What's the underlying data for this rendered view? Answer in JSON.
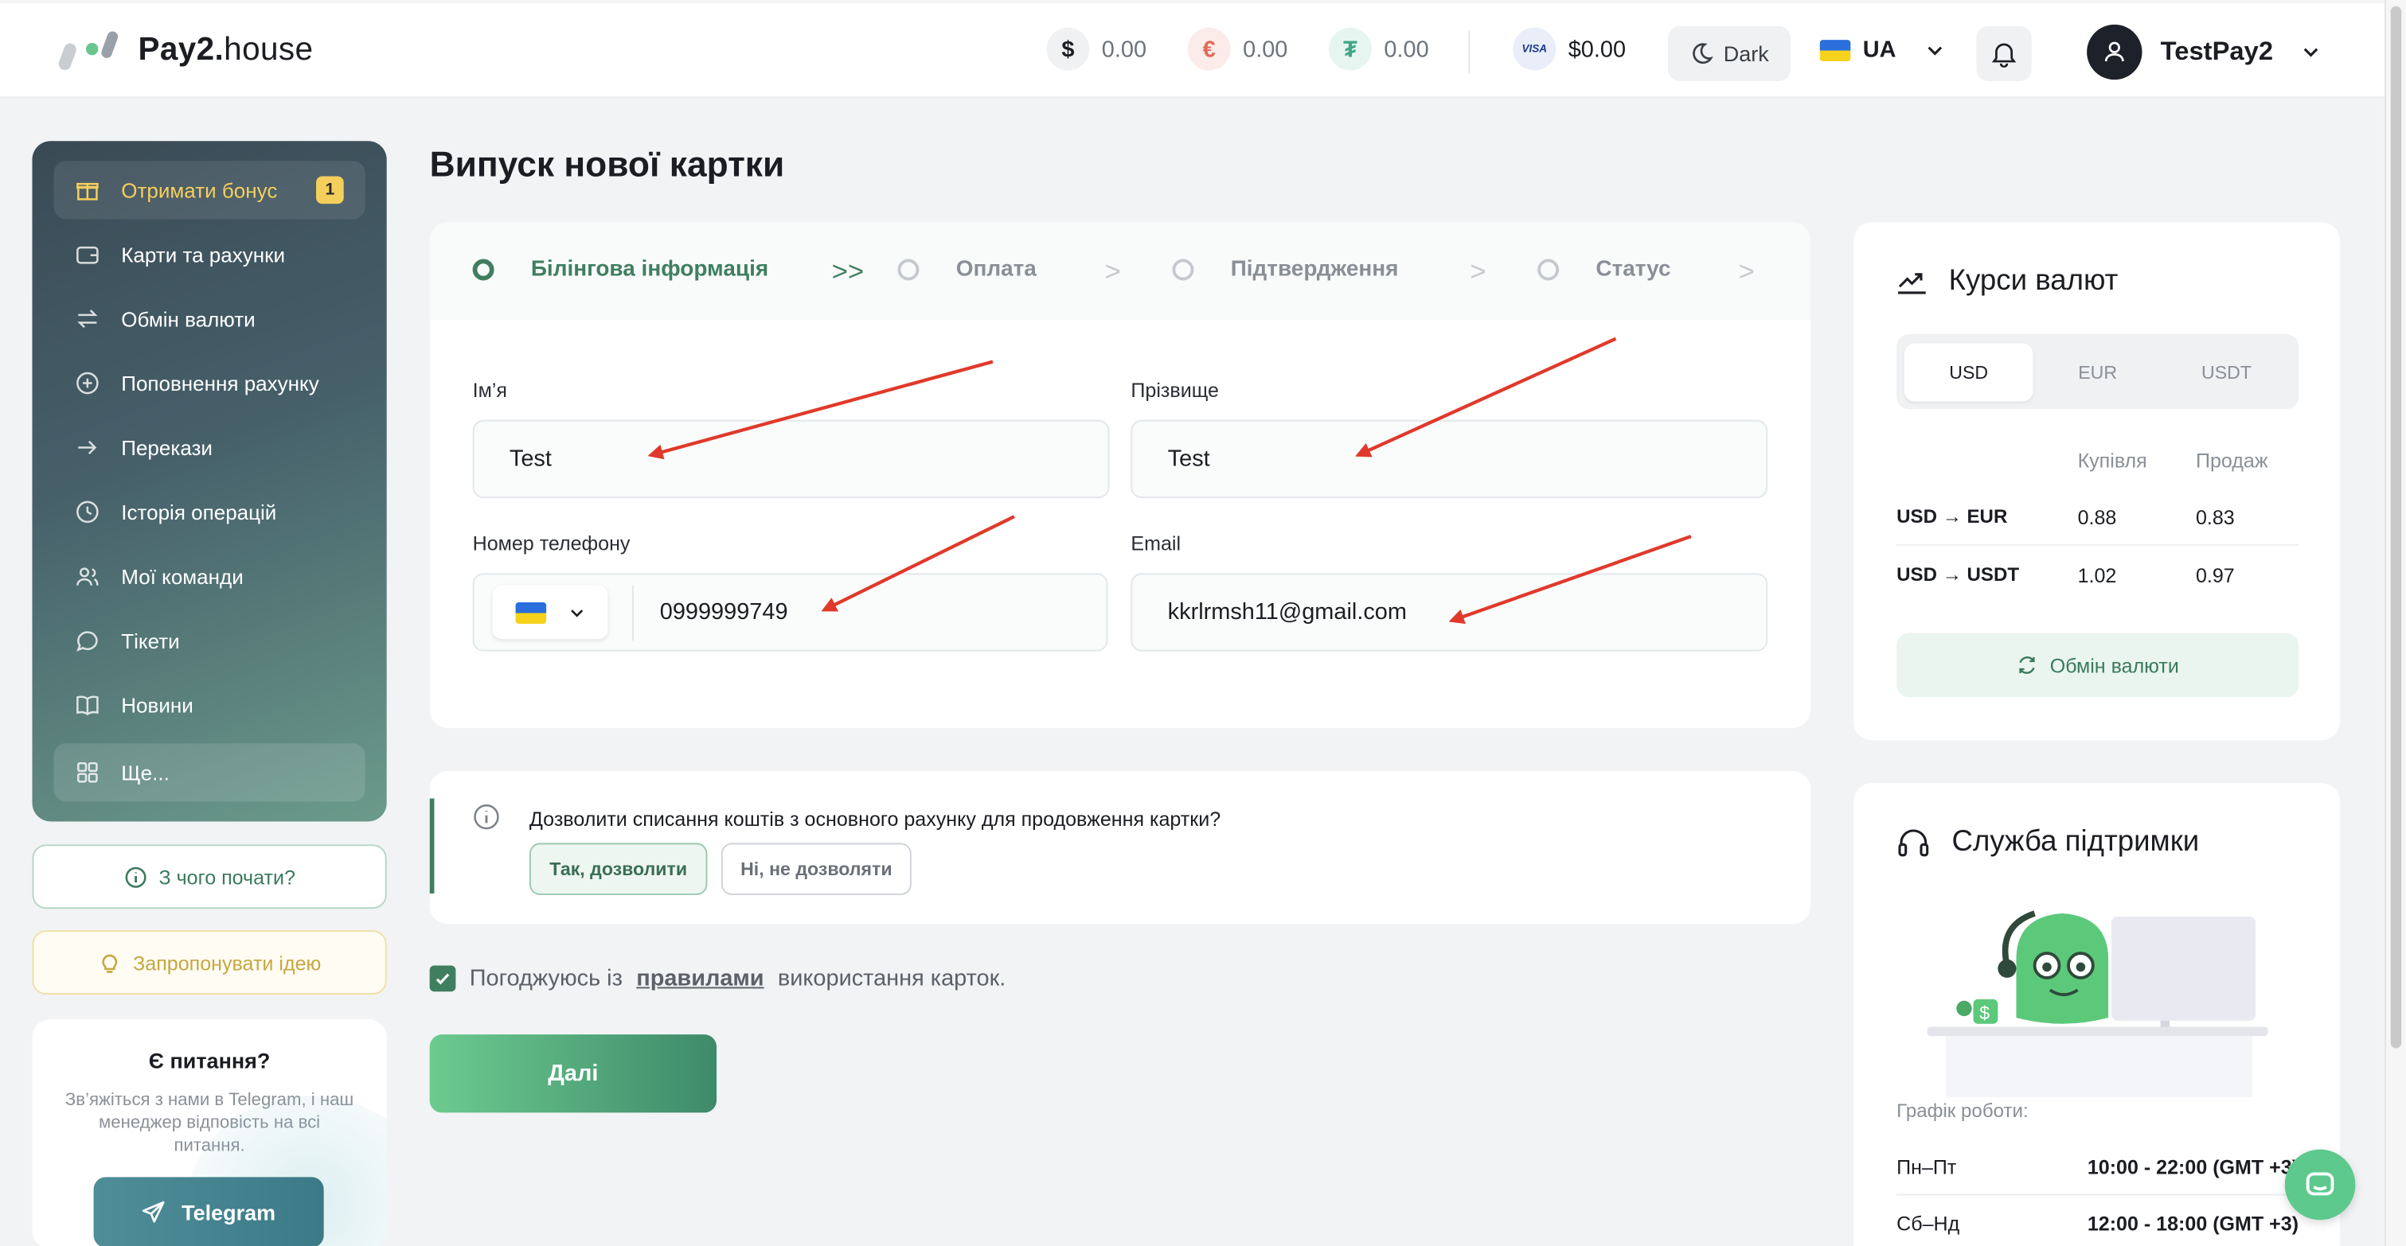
{
  "header": {
    "logo_main": "Pay2.",
    "logo_sub": "house",
    "balances": [
      {
        "symbol": "$",
        "value": "0.00",
        "icon": "dollar-coin-icon",
        "color": "#1b1d22"
      },
      {
        "symbol": "€",
        "value": "0.00",
        "icon": "euro-coin-icon",
        "color": "#e06b5a"
      },
      {
        "symbol": "₮",
        "value": "0.00",
        "icon": "tether-coin-icon",
        "color": "#3fa788"
      }
    ],
    "visa_label": "VISA",
    "visa_balance": "$0.00",
    "theme_label": "Dark",
    "language": "UA",
    "username": "TestPay2"
  },
  "sidebar": {
    "items": [
      {
        "label": "Отримати бонус",
        "icon": "gift-icon",
        "badge": "1"
      },
      {
        "label": "Карти та рахунки",
        "icon": "wallet-icon"
      },
      {
        "label": "Обмін валюти",
        "icon": "exchange-icon"
      },
      {
        "label": "Поповнення рахунку",
        "icon": "plus-circle-icon"
      },
      {
        "label": "Перекази",
        "icon": "arrow-right-icon"
      },
      {
        "label": "Історія операцій",
        "icon": "clock-icon"
      },
      {
        "label": "Мої команди",
        "icon": "users-icon"
      },
      {
        "label": "Тікети",
        "icon": "chat-icon"
      },
      {
        "label": "Новини",
        "icon": "book-icon"
      },
      {
        "label": "Ще...",
        "icon": "grid-icon"
      }
    ],
    "start_label": "З чого почати?",
    "idea_label": "Запропонувати ідею",
    "qa_title": "Є питання?",
    "qa_text": "Зв’яжіться з нами в Telegram, і наш менеджер відповість на всі питання.",
    "telegram_label": "Telegram"
  },
  "main": {
    "title": "Випуск нової картки",
    "steps": [
      "Білінгова інформація",
      "Оплата",
      "Підтвердження",
      "Статус"
    ],
    "first_name_label": "Ім’я",
    "first_name_value": "Test",
    "last_name_label": "Прізвище",
    "last_name_value": "Test",
    "phone_label": "Номер телефону",
    "phone_value": "0999999749",
    "email_label": "Email",
    "email_value": "kkrlrmsh11@gmail.com",
    "allow_question": "Дозволити списання коштів з основного рахунку для продовження картки?",
    "allow_yes": "Так, дозволити",
    "allow_no": "Ні, не дозволяти",
    "agree_prefix": "Погоджуюсь із",
    "agree_link": "правилами",
    "agree_suffix": "використання карток.",
    "next_label": "Далі"
  },
  "rates": {
    "title": "Курси валют",
    "tabs": [
      "USD",
      "EUR",
      "USDT"
    ],
    "col_buy": "Купівля",
    "col_sell": "Продаж",
    "rows": [
      {
        "pair": "USD → EUR",
        "buy": "0.88",
        "sell": "0.83"
      },
      {
        "pair": "USD → USDT",
        "buy": "1.02",
        "sell": "0.97"
      }
    ],
    "exchange_label": "Обмін валюти"
  },
  "support": {
    "title": "Служба підтримки",
    "hours_label": "Графік роботи:",
    "rows": [
      {
        "days": "Пн–Пт",
        "time": "10:00 - 22:00 (GMT +3)"
      },
      {
        "days": "Сб–Нд",
        "time": "12:00 - 18:00 (GMT +3)"
      }
    ]
  },
  "colors": {
    "accent": "#3f7f60",
    "annotation_arrow": "#e0392b"
  }
}
